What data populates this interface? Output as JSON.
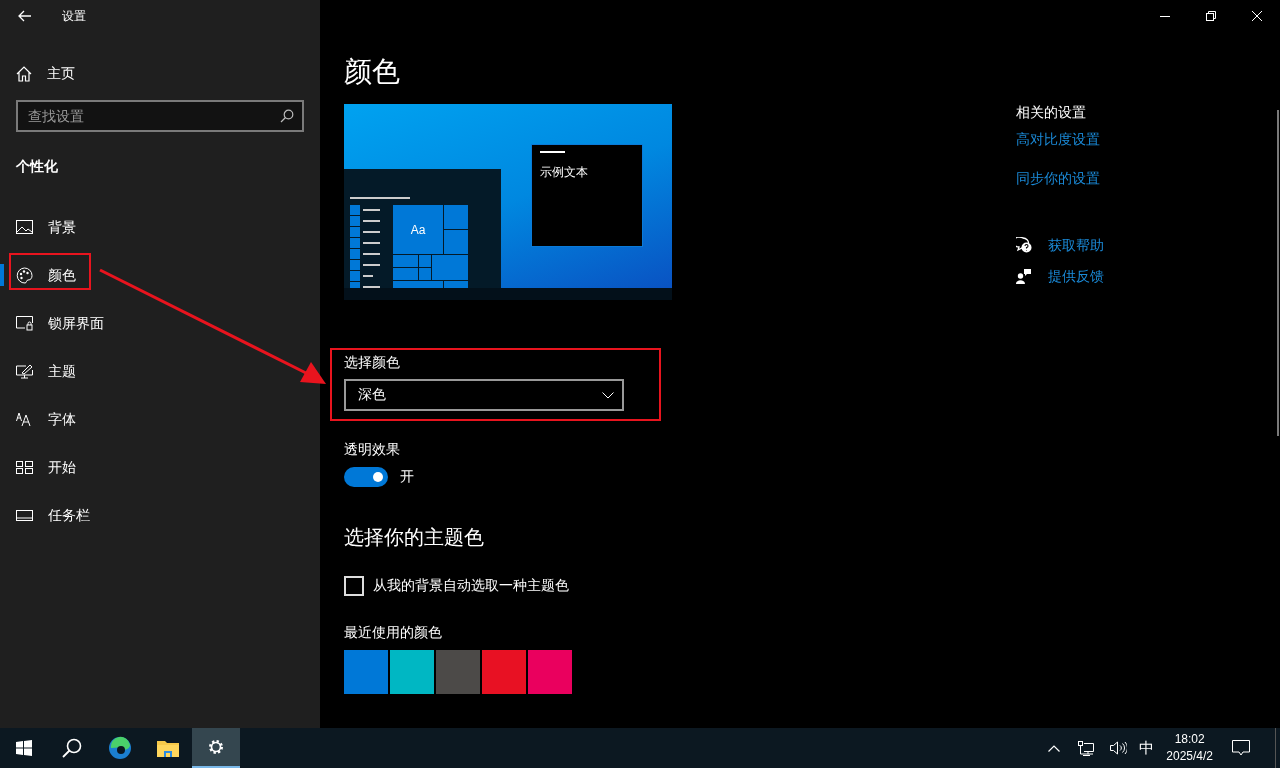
{
  "window": {
    "title": "设置"
  },
  "sidebar": {
    "home": "主页",
    "search": {
      "placeholder": "查找设置"
    },
    "section": "个性化",
    "items": [
      {
        "label": "背景",
        "selected": false
      },
      {
        "label": "颜色",
        "selected": true
      },
      {
        "label": "锁屏界面",
        "selected": false
      },
      {
        "label": "主题",
        "selected": false
      },
      {
        "label": "字体",
        "selected": false
      },
      {
        "label": "开始",
        "selected": false
      },
      {
        "label": "任务栏",
        "selected": false
      }
    ]
  },
  "main": {
    "title": "颜色",
    "preview": {
      "tile_text": "Aa",
      "sample_text": "示例文本"
    },
    "color_mode": {
      "label": "选择颜色",
      "value": "深色"
    },
    "transparency": {
      "label": "透明效果",
      "on": true,
      "state_text": "开"
    },
    "accent_heading": "选择你的主题色",
    "auto_accent": {
      "label": "从我的背景自动选取一种主题色",
      "checked": false
    },
    "recent": {
      "label": "最近使用的颜色",
      "colors": [
        {
          "color": "#0078d7"
        },
        {
          "color": "#00b7c3"
        },
        {
          "color": "#4c4a48"
        },
        {
          "color": "#e81123"
        },
        {
          "color": "#ea005e"
        }
      ]
    }
  },
  "related": {
    "heading": "相关的设置",
    "links": [
      "高对比度设置",
      "同步你的设置"
    ],
    "help": [
      "获取帮助",
      "提供反馈"
    ]
  },
  "taskbar": {
    "apps": [
      {
        "selected": false
      },
      {
        "selected": false
      },
      {
        "selected": true
      }
    ],
    "ime": "中",
    "time": "18:02",
    "date": "2025/4/2"
  }
}
